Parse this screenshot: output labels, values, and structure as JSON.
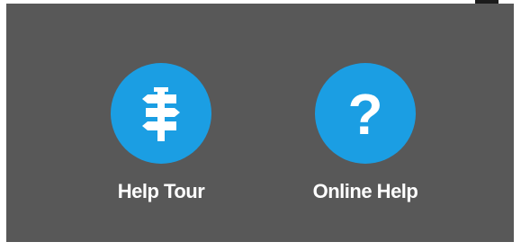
{
  "help_options": {
    "tour": {
      "label": "Help Tour",
      "icon": "signpost-icon"
    },
    "online": {
      "label": "Online Help",
      "icon": "question-mark-icon",
      "glyph": "?"
    }
  },
  "colors": {
    "panel_background": "#585858",
    "icon_circle": "#1b9ee3",
    "label_text": "#ffffff"
  }
}
